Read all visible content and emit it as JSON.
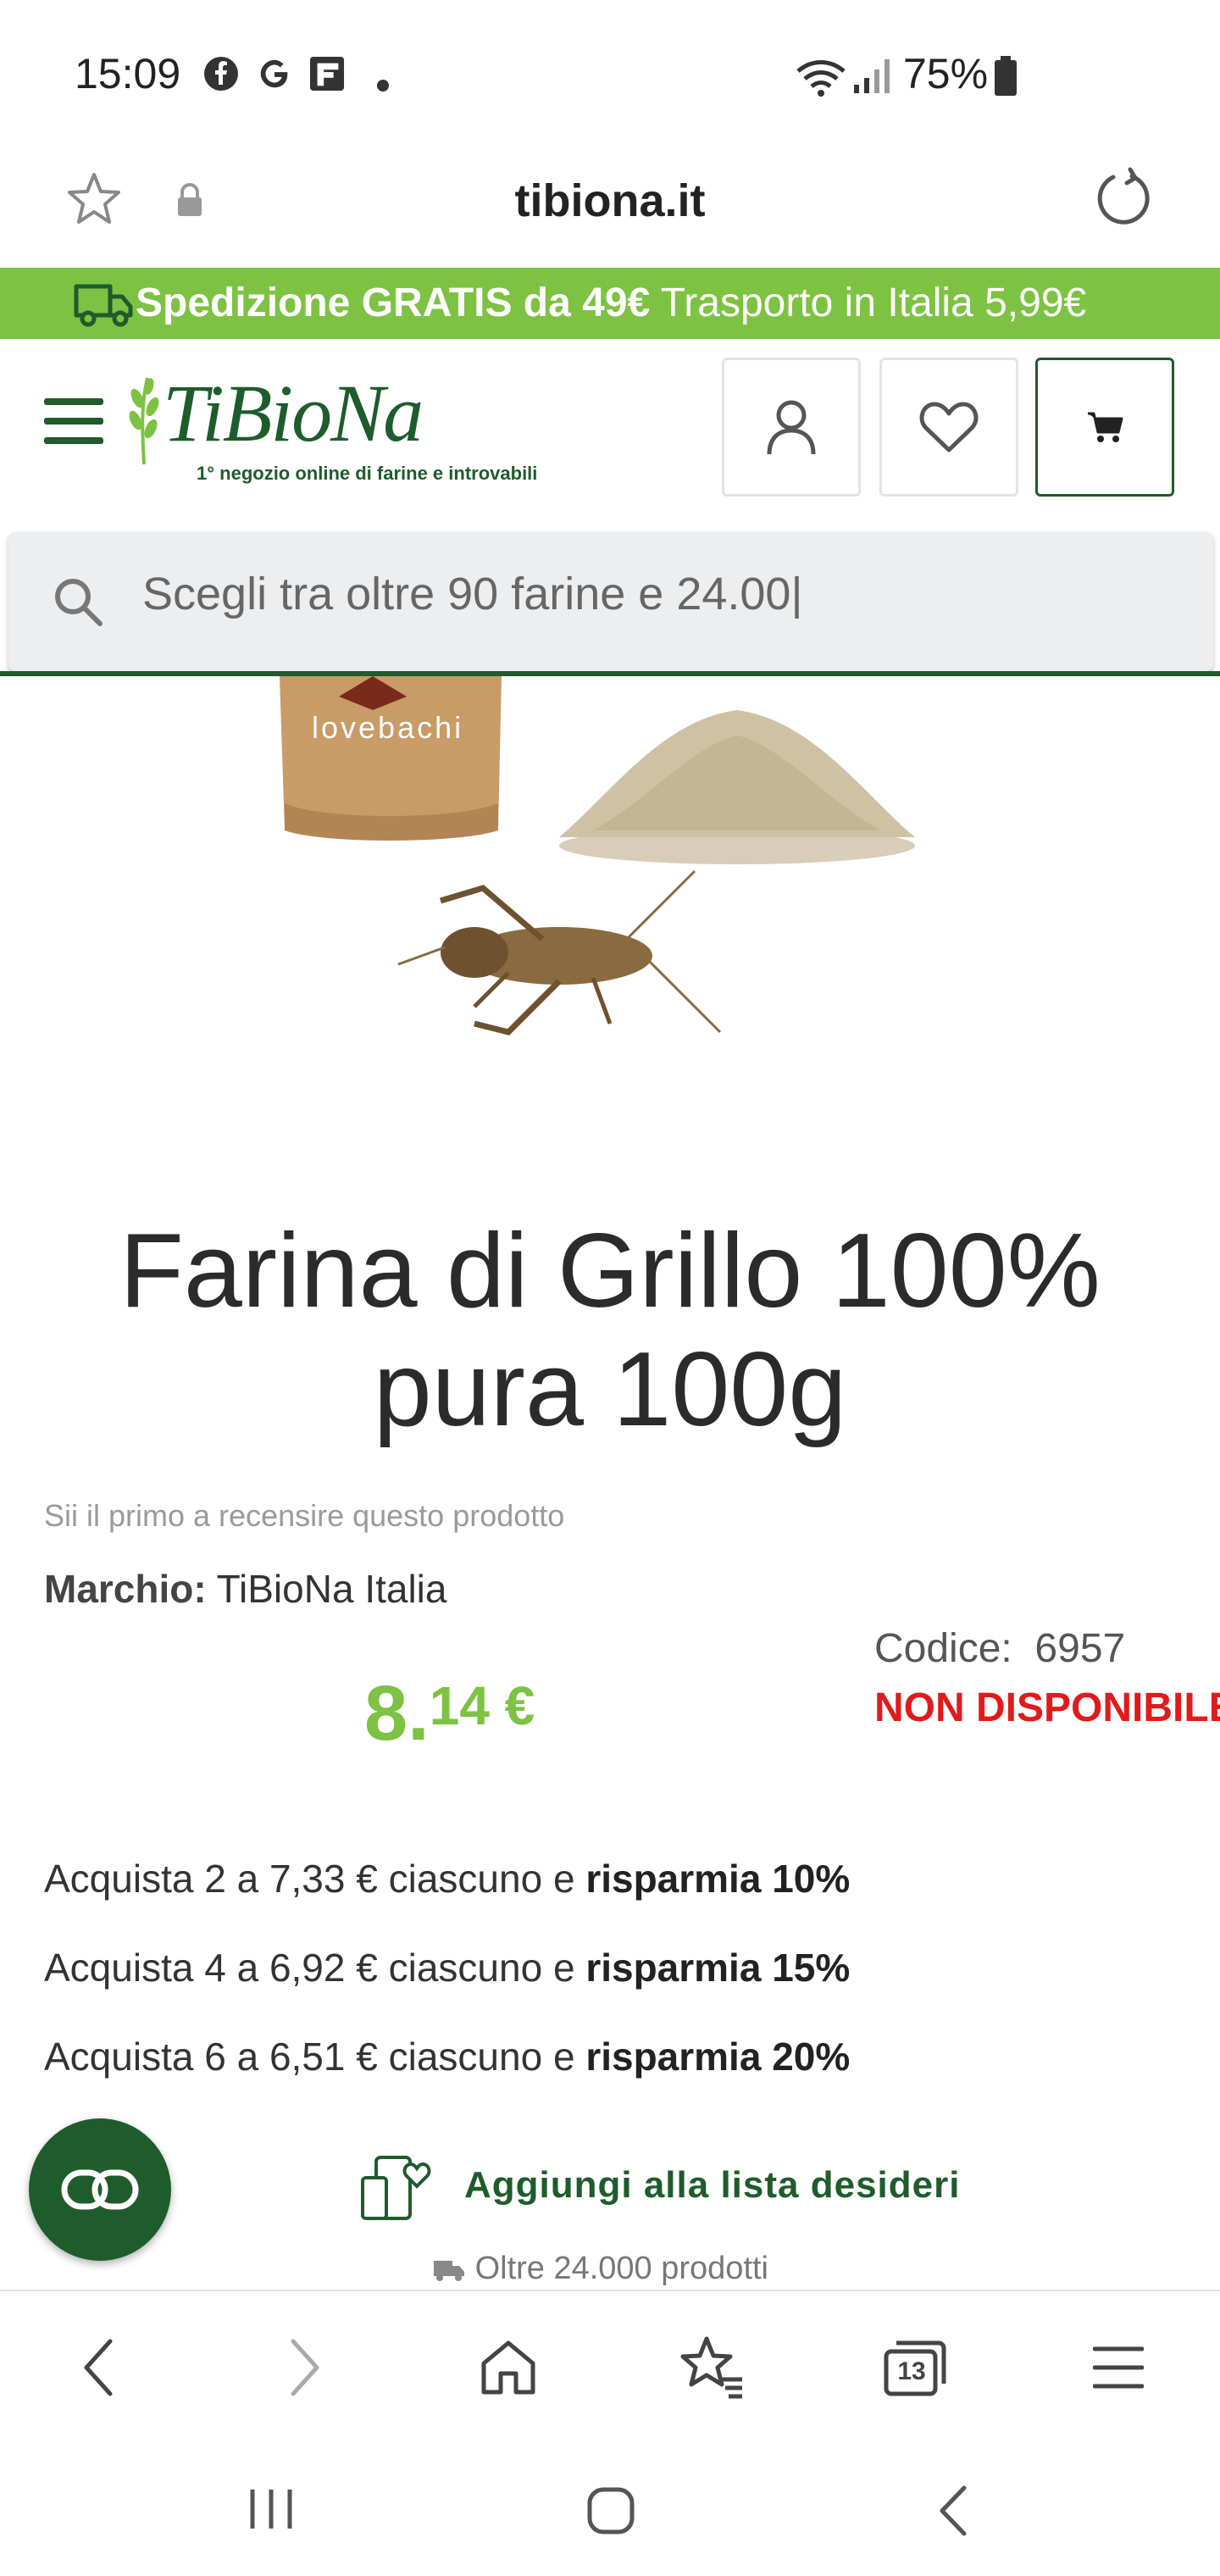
{
  "status_bar": {
    "time": "15:09",
    "notification_icons": [
      "facebook-icon",
      "google-icon",
      "flipboard-icon",
      "dot-icon"
    ],
    "battery": "75%"
  },
  "url_bar": {
    "domain": "tibiona.it"
  },
  "promo": {
    "bold_text": "Spedizione GRATIS da 49€",
    "text": " Trasporto in Italia 5,99€"
  },
  "header": {
    "logo_text": "TiBioNa",
    "logo_tagline": "1° negozio online di farine e introvabili"
  },
  "search": {
    "placeholder": "Scegli tra oltre 90 farine e 24.00|"
  },
  "image": {
    "package_brand": "lovebachi"
  },
  "product": {
    "title": "Farina di Grillo 100% pura 100g",
    "review_prompt": "Sii il primo a recensire questo prodotto",
    "brand_label": "Marchio:",
    "brand_value": " TiBioNa Italia",
    "code_label": "Codice:",
    "code_value": "6957",
    "availability": "NON DISPONIBILE",
    "price_int": "8.",
    "price_dec": "14 €"
  },
  "tiers": [
    {
      "text": "Acquista 2 a 7,33 € ciascuno e ",
      "bold": "risparmia 10%"
    },
    {
      "text": "Acquista 4 a 6,92 € ciascuno e ",
      "bold": "risparmia 15%"
    },
    {
      "text": "Acquista 6 a 6,51 € ciascuno e ",
      "bold": "risparmia 20%"
    }
  ],
  "wishlist_label": "Aggiungi alla lista desideri",
  "shipping_note": "Oltre 24.000 prodotti",
  "bottom_bar": {
    "tabs_count": "13"
  },
  "colors": {
    "brand_green": "#1e5c2c",
    "accent_green": "#7dc242",
    "unavailable_red": "#e01b1b"
  }
}
